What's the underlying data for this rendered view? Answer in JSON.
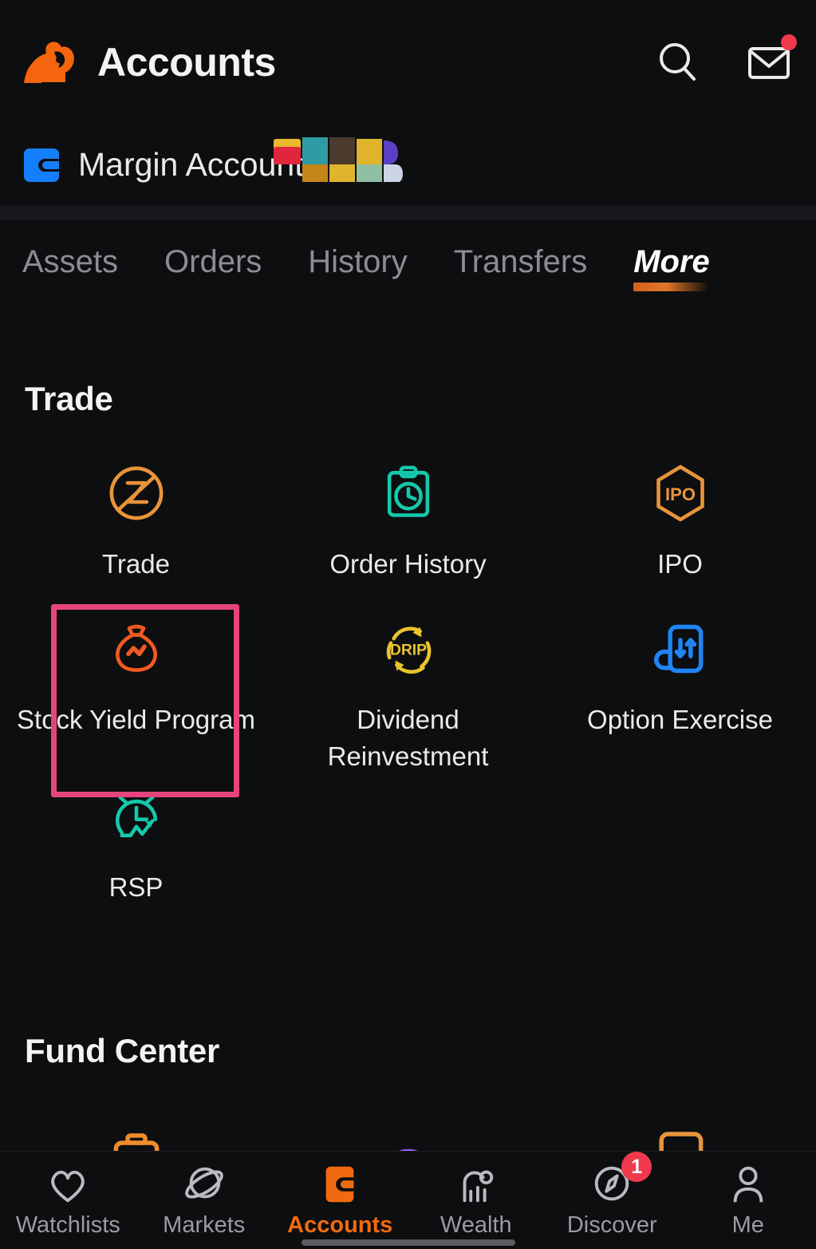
{
  "header": {
    "logo_icon": "moomoo-bull-logo",
    "title": "Accounts",
    "search_icon": "search-icon",
    "mail_icon": "mail-icon",
    "mail_has_badge": true,
    "accent_color": "#f06a10"
  },
  "account": {
    "wallet_icon": "wallet-icon",
    "name": "Margin Account",
    "overlay_graphic": "color-blocks-overlay"
  },
  "tabs": [
    {
      "label": "Assets",
      "active": false
    },
    {
      "label": "Orders",
      "active": false
    },
    {
      "label": "History",
      "active": false
    },
    {
      "label": "Transfers",
      "active": false
    },
    {
      "label": "More",
      "active": true
    }
  ],
  "sections": [
    {
      "title": "Trade",
      "items": [
        {
          "label": "Trade",
          "icon": "trade-circle-z-icon",
          "color": "#e8943a",
          "highlighted": false
        },
        {
          "label": "Order History",
          "icon": "clipboard-clock-icon",
          "color": "#14c9ab",
          "highlighted": false
        },
        {
          "label": "IPO",
          "icon": "ipo-hexagon-icon",
          "color": "#e8943a",
          "highlighted": false
        },
        {
          "label": "Stock Yield Program",
          "icon": "money-bag-icon",
          "color": "#ef5a22",
          "highlighted": true
        },
        {
          "label": "Dividend Reinvestment",
          "icon": "drip-refresh-icon",
          "color": "#e9c42c",
          "highlighted": false
        },
        {
          "label": "Option Exercise",
          "icon": "option-exercise-icon",
          "color": "#2084f5",
          "highlighted": false
        },
        {
          "label": "RSP",
          "icon": "alarm-clock-chart-icon",
          "color": "#14c9ab",
          "highlighted": false
        }
      ]
    },
    {
      "title": "Fund Center",
      "items": [
        {
          "label": "",
          "icon": "briefcase-icon",
          "color": "#f08b2a",
          "highlighted": false
        },
        {
          "label": "",
          "icon": "piggy-bank-icon",
          "color": "#9b5cf0",
          "highlighted": false
        },
        {
          "label": "",
          "icon": "card-box-icon",
          "color": "#e8943a",
          "highlighted": false
        }
      ]
    }
  ],
  "highlight": {
    "target": "Stock Yield Program",
    "border_color": "#e6447d"
  },
  "bottom_nav": [
    {
      "label": "Watchlists",
      "icon": "heart-icon",
      "active": false,
      "badge": ""
    },
    {
      "label": "Markets",
      "icon": "planet-icon",
      "active": false,
      "badge": ""
    },
    {
      "label": "Accounts",
      "icon": "wallet-icon",
      "active": true,
      "badge": ""
    },
    {
      "label": "Wealth",
      "icon": "wealth-chart-icon",
      "active": false,
      "badge": ""
    },
    {
      "label": "Discover",
      "icon": "compass-icon",
      "active": false,
      "badge": "1"
    },
    {
      "label": "Me",
      "icon": "person-icon",
      "active": false,
      "badge": ""
    }
  ]
}
